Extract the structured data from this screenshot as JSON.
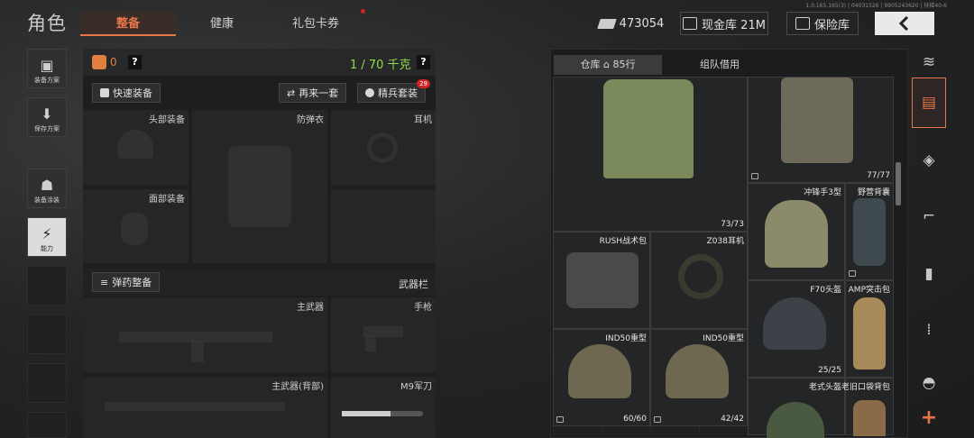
{
  "header": {
    "title": "角色",
    "version": "1.0.165.165(3) | 04031526 | 9905243620 | 扶摇40-6",
    "tabs": [
      {
        "label": "整备",
        "active": true
      },
      {
        "label": "健康",
        "active": false
      },
      {
        "label": "礼包卡券",
        "active": false,
        "has_notification": true
      }
    ],
    "currency_value": "473054",
    "cash_storage_label": "现金库 21M",
    "safe_label": "保险库"
  },
  "left_rail": [
    {
      "label": "装备方案",
      "icon": "vest-plan-icon"
    },
    {
      "label": "保存方案",
      "icon": "save-icon"
    },
    {
      "label": "装备涂装",
      "icon": "paint-icon"
    },
    {
      "label": "能力",
      "icon": "ability-icon",
      "selected": true
    }
  ],
  "loadout": {
    "bag_count": "0",
    "help": "?",
    "weight": "1 / 70 千克",
    "quick_equip_label": "快速装备",
    "repeat_label": "再来一套",
    "elite_label": "精兵套装",
    "elite_badge": "29",
    "slots": {
      "head": "头部装备",
      "armor": "防弹衣",
      "headset": "耳机",
      "face": "面部装备"
    },
    "ammo_label": "弹药整备",
    "weapon_bar_label": "武器栏",
    "primary": "主武器",
    "pistol": "手枪",
    "primary_back": "主武器(背部)",
    "knife": "M9军刀"
  },
  "warehouse": {
    "tab_storage": "仓库",
    "tab_rows": "85行",
    "tab_team": "组队借用",
    "items": [
      {
        "name": "",
        "count": "73/73"
      },
      {
        "name": "",
        "count": "77/77"
      },
      {
        "name": "冲锋手3型",
        "count": ""
      },
      {
        "name": "野营背囊",
        "count": ""
      },
      {
        "name": "RUSH战术包",
        "count": ""
      },
      {
        "name": "Z038耳机",
        "count": ""
      },
      {
        "name": "F70头盔",
        "count": "25/25"
      },
      {
        "name": "AMP突击包",
        "count": ""
      },
      {
        "name": "IND50重型",
        "count": "60/60"
      },
      {
        "name": "IND50重型",
        "count": "42/42"
      },
      {
        "name": "老式头盔",
        "count": ""
      },
      {
        "name": "老旧口袋背包",
        "count": ""
      }
    ]
  },
  "categories": [
    "all-icon",
    "armor-icon",
    "bag-icon",
    "rifle-icon",
    "magazine-icon",
    "ammo-icon",
    "helmet-icon",
    "add-icon"
  ],
  "colors": {
    "accent": "#e8764a",
    "weight_ok": "#8fdc4a",
    "badge": "#d02424"
  }
}
